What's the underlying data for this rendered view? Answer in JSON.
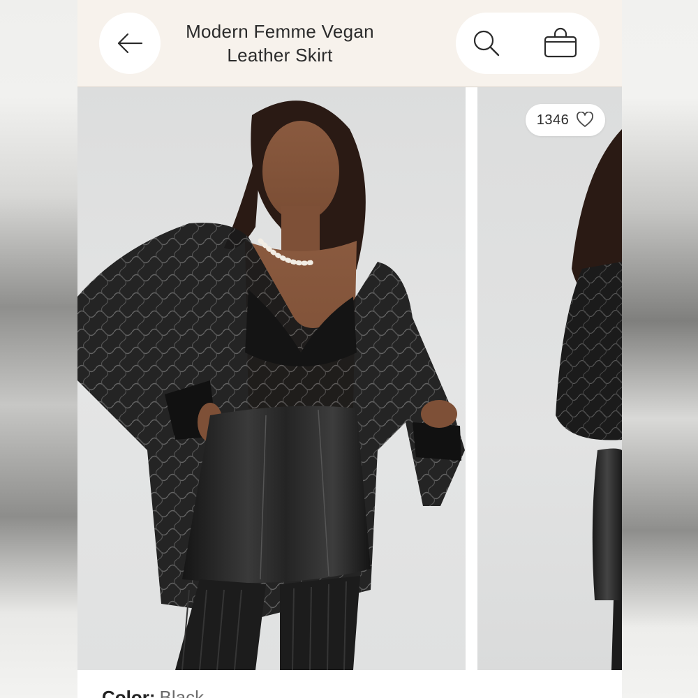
{
  "header": {
    "title": "Modern Femme Vegan Leather Skirt",
    "back_icon": "arrow-left-icon",
    "search_icon": "search-icon",
    "bag_icon": "shopping-bag-icon",
    "background": "#f7f2ec"
  },
  "gallery": {
    "images": [
      {
        "alt": "Model wearing black lace top and vegan leather mini skirt, front view"
      },
      {
        "alt": "Model wearing vegan leather skirt, side view"
      }
    ],
    "likes": {
      "count": "1346",
      "icon": "heart-icon"
    }
  },
  "product": {
    "color_label": "Color:",
    "color_value": "Black"
  }
}
